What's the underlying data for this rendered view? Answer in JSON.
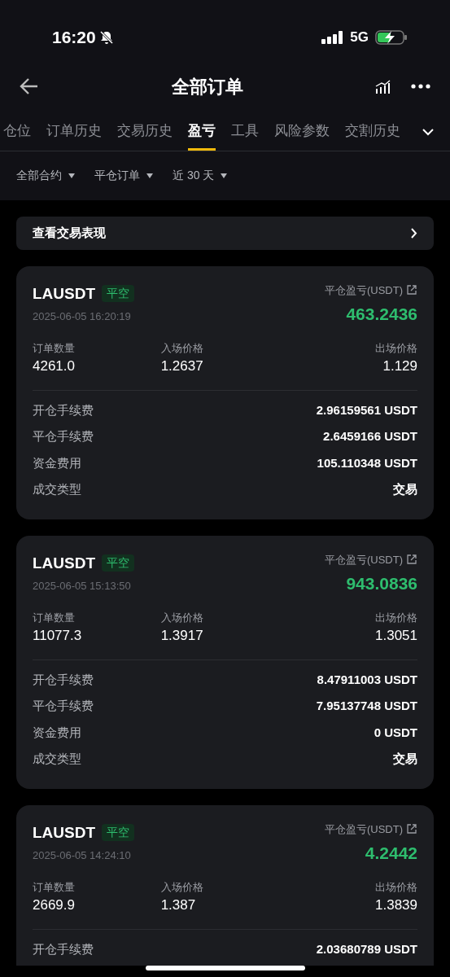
{
  "status_bar": {
    "time": "16:20",
    "network": "5G"
  },
  "header": {
    "title": "全部订单"
  },
  "tabs": [
    {
      "label": "仓位",
      "selected": false
    },
    {
      "label": "订单历史",
      "selected": false
    },
    {
      "label": "交易历史",
      "selected": false
    },
    {
      "label": "盈亏",
      "selected": true
    },
    {
      "label": "工具",
      "selected": false
    },
    {
      "label": "风险参数",
      "selected": false
    },
    {
      "label": "交割历史",
      "selected": false
    }
  ],
  "filters": [
    "全部合约",
    "平仓订单",
    "近 30 天"
  ],
  "performance_link": "查看交易表现",
  "orders": [
    {
      "symbol": "LAUSDT",
      "tag": "平空",
      "time": "2025-06-05 16:20:19",
      "pnl_label": "平仓盈亏(USDT)",
      "pnl": "463.2436",
      "qty_label": "订单数量",
      "qty": "4261.0",
      "entry_label": "入场价格",
      "entry": "1.2637",
      "exit_label": "出场价格",
      "exit": "1.129",
      "details": [
        {
          "label": "开仓手续费",
          "value": "2.96159561 USDT"
        },
        {
          "label": "平仓手续费",
          "value": "2.6459166 USDT"
        },
        {
          "label": "资金费用",
          "value": "105.110348 USDT"
        },
        {
          "label": "成交类型",
          "value": "交易"
        }
      ]
    },
    {
      "symbol": "LAUSDT",
      "tag": "平空",
      "time": "2025-06-05 15:13:50",
      "pnl_label": "平仓盈亏(USDT)",
      "pnl": "943.0836",
      "qty_label": "订单数量",
      "qty": "11077.3",
      "entry_label": "入场价格",
      "entry": "1.3917",
      "exit_label": "出场价格",
      "exit": "1.3051",
      "details": [
        {
          "label": "开仓手续费",
          "value": "8.47911003 USDT"
        },
        {
          "label": "平仓手续费",
          "value": "7.95137748 USDT"
        },
        {
          "label": "资金费用",
          "value": "0 USDT"
        },
        {
          "label": "成交类型",
          "value": "交易"
        }
      ]
    },
    {
      "symbol": "LAUSDT",
      "tag": "平空",
      "time": "2025-06-05 14:24:10",
      "pnl_label": "平仓盈亏(USDT)",
      "pnl": "4.2442",
      "qty_label": "订单数量",
      "qty": "2669.9",
      "entry_label": "入场价格",
      "entry": "1.387",
      "exit_label": "出场价格",
      "exit": "1.3839",
      "details": [
        {
          "label": "开仓手续费",
          "value": "2.03680789 USDT"
        }
      ]
    }
  ]
}
